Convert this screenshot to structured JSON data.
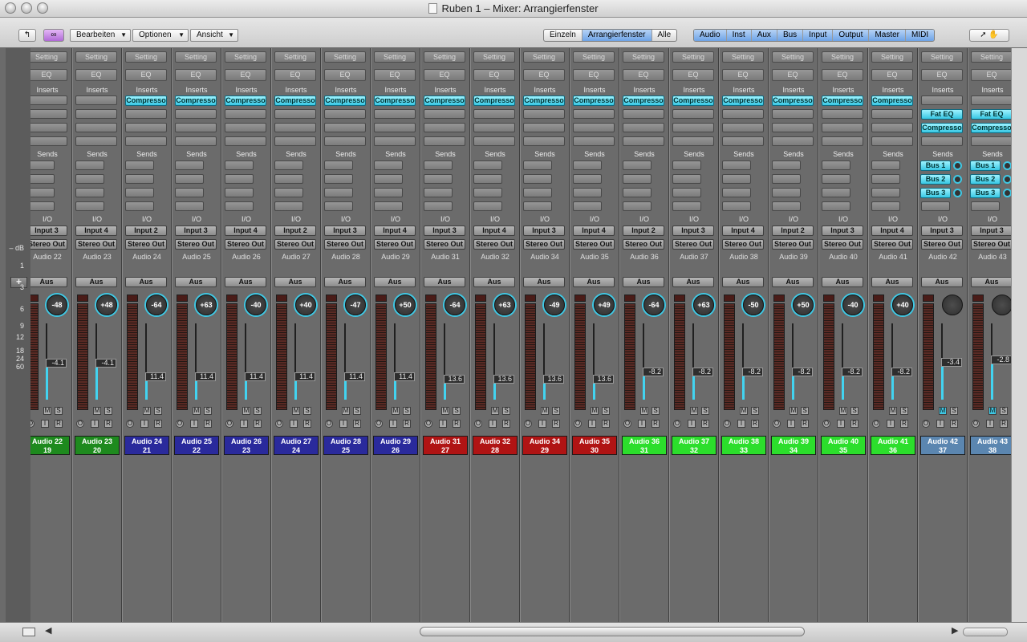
{
  "window": {
    "title": "Ruben 1 – Mixer: Arrangierfenster"
  },
  "toolbar": {
    "menus": [
      "Bearbeiten",
      "Optionen",
      "Ansicht"
    ],
    "view_modes": [
      {
        "label": "Einzeln",
        "active": false
      },
      {
        "label": "Arrangierfenster",
        "active": true
      },
      {
        "label": "Alle",
        "active": false
      }
    ],
    "filters": [
      "Audio",
      "Inst",
      "Aux",
      "Bus",
      "Input",
      "Output",
      "Master",
      "MIDI"
    ]
  },
  "db_scale": [
    "– dB",
    "1",
    "3",
    "6",
    "9",
    "12",
    "18",
    "24",
    "60"
  ],
  "labels": {
    "setting": "Setting",
    "eq": "EQ",
    "inserts": "Inserts",
    "sends": "Sends",
    "io": "I/O",
    "output": "Stereo Out",
    "automation": "Aus",
    "m": "M",
    "s": "S",
    "o": "O",
    "i": "I",
    "r": "R",
    "add": "+"
  },
  "colors": {
    "green": "#1e8a1e",
    "blue": "#2a2a9c",
    "red": "#b01414",
    "lime": "#2cde2c",
    "grey": "#5b86b0",
    "accent": "#3fc8e4"
  },
  "strips": [
    {
      "name": "Audio 22",
      "number": "19",
      "input": "Input 3",
      "pan": "-48",
      "volume": "-4.1",
      "level": 0.5,
      "color": "green",
      "inserts": []
    },
    {
      "name": "Audio 23",
      "number": "20",
      "input": "Input 4",
      "pan": "+48",
      "volume": "-4.1",
      "level": 0.5,
      "color": "green",
      "inserts": []
    },
    {
      "name": "Audio 24",
      "number": "21",
      "input": "Input 2",
      "pan": "-64",
      "volume": "11.4",
      "level": 0.3,
      "color": "blue",
      "inserts": [
        "Compresso"
      ]
    },
    {
      "name": "Audio 25",
      "number": "22",
      "input": "Input 3",
      "pan": "+63",
      "volume": "11.4",
      "level": 0.3,
      "color": "blue",
      "inserts": [
        "Compresso"
      ]
    },
    {
      "name": "Audio 26",
      "number": "23",
      "input": "Input 4",
      "pan": "-40",
      "volume": "11.4",
      "level": 0.3,
      "color": "blue",
      "inserts": [
        "Compresso"
      ]
    },
    {
      "name": "Audio 27",
      "number": "24",
      "input": "Input 2",
      "pan": "+40",
      "volume": "11.4",
      "level": 0.3,
      "color": "blue",
      "inserts": [
        "Compresso"
      ]
    },
    {
      "name": "Audio 28",
      "number": "25",
      "input": "Input 3",
      "pan": "-47",
      "volume": "11.4",
      "level": 0.3,
      "color": "blue",
      "inserts": [
        "Compresso"
      ]
    },
    {
      "name": "Audio 29",
      "number": "26",
      "input": "Input 4",
      "pan": "+50",
      "volume": "11.4",
      "level": 0.3,
      "color": "blue",
      "inserts": [
        "Compresso"
      ]
    },
    {
      "name": "Audio 31",
      "number": "27",
      "input": "Input 3",
      "pan": "-64",
      "volume": "13.6",
      "level": 0.27,
      "color": "red",
      "inserts": [
        "Compresso"
      ]
    },
    {
      "name": "Audio 32",
      "number": "28",
      "input": "Input 4",
      "pan": "+63",
      "volume": "13.6",
      "level": 0.27,
      "color": "red",
      "inserts": [
        "Compresso"
      ]
    },
    {
      "name": "Audio 34",
      "number": "29",
      "input": "Input 3",
      "pan": "-49",
      "volume": "13.6",
      "level": 0.27,
      "color": "red",
      "inserts": [
        "Compresso"
      ]
    },
    {
      "name": "Audio 35",
      "number": "30",
      "input": "Input 4",
      "pan": "+49",
      "volume": "13.6",
      "level": 0.27,
      "color": "red",
      "inserts": [
        "Compresso"
      ]
    },
    {
      "name": "Audio 36",
      "number": "31",
      "input": "Input 2",
      "pan": "-64",
      "volume": "-8.2",
      "level": 0.38,
      "color": "lime",
      "inserts": [
        "Compresso"
      ]
    },
    {
      "name": "Audio 37",
      "number": "32",
      "input": "Input 3",
      "pan": "+63",
      "volume": "-8.2",
      "level": 0.38,
      "color": "lime",
      "inserts": [
        "Compresso"
      ]
    },
    {
      "name": "Audio 38",
      "number": "33",
      "input": "Input 4",
      "pan": "-50",
      "volume": "-8.2",
      "level": 0.38,
      "color": "lime",
      "inserts": [
        "Compresso"
      ]
    },
    {
      "name": "Audio 39",
      "number": "34",
      "input": "Input 2",
      "pan": "+50",
      "volume": "-8.2",
      "level": 0.38,
      "color": "lime",
      "inserts": [
        "Compresso"
      ]
    },
    {
      "name": "Audio 40",
      "number": "35",
      "input": "Input 3",
      "pan": "-40",
      "volume": "-8.2",
      "level": 0.38,
      "color": "lime",
      "inserts": [
        "Compresso"
      ]
    },
    {
      "name": "Audio 41",
      "number": "36",
      "input": "Input 4",
      "pan": "+40",
      "volume": "-8.2",
      "level": 0.38,
      "color": "lime",
      "inserts": [
        "Compresso"
      ]
    },
    {
      "name": "Audio 42",
      "number": "37",
      "input": "Input 3",
      "pan": "",
      "volume": "-3.4",
      "level": 0.52,
      "color": "grey",
      "inserts": [
        "Fat EQ",
        "Compresso"
      ],
      "sends": [
        "Bus 1",
        "Bus 2",
        "Bus 3"
      ],
      "muted": true
    },
    {
      "name": "Audio 43",
      "number": "38",
      "input": "Input 3",
      "pan": "",
      "volume": "-2.8",
      "level": 0.55,
      "color": "grey",
      "inserts": [
        "Fat EQ",
        "Compresso"
      ],
      "sends": [
        "Bus 1",
        "Bus 2",
        "Bus 3"
      ],
      "muted": true
    }
  ]
}
